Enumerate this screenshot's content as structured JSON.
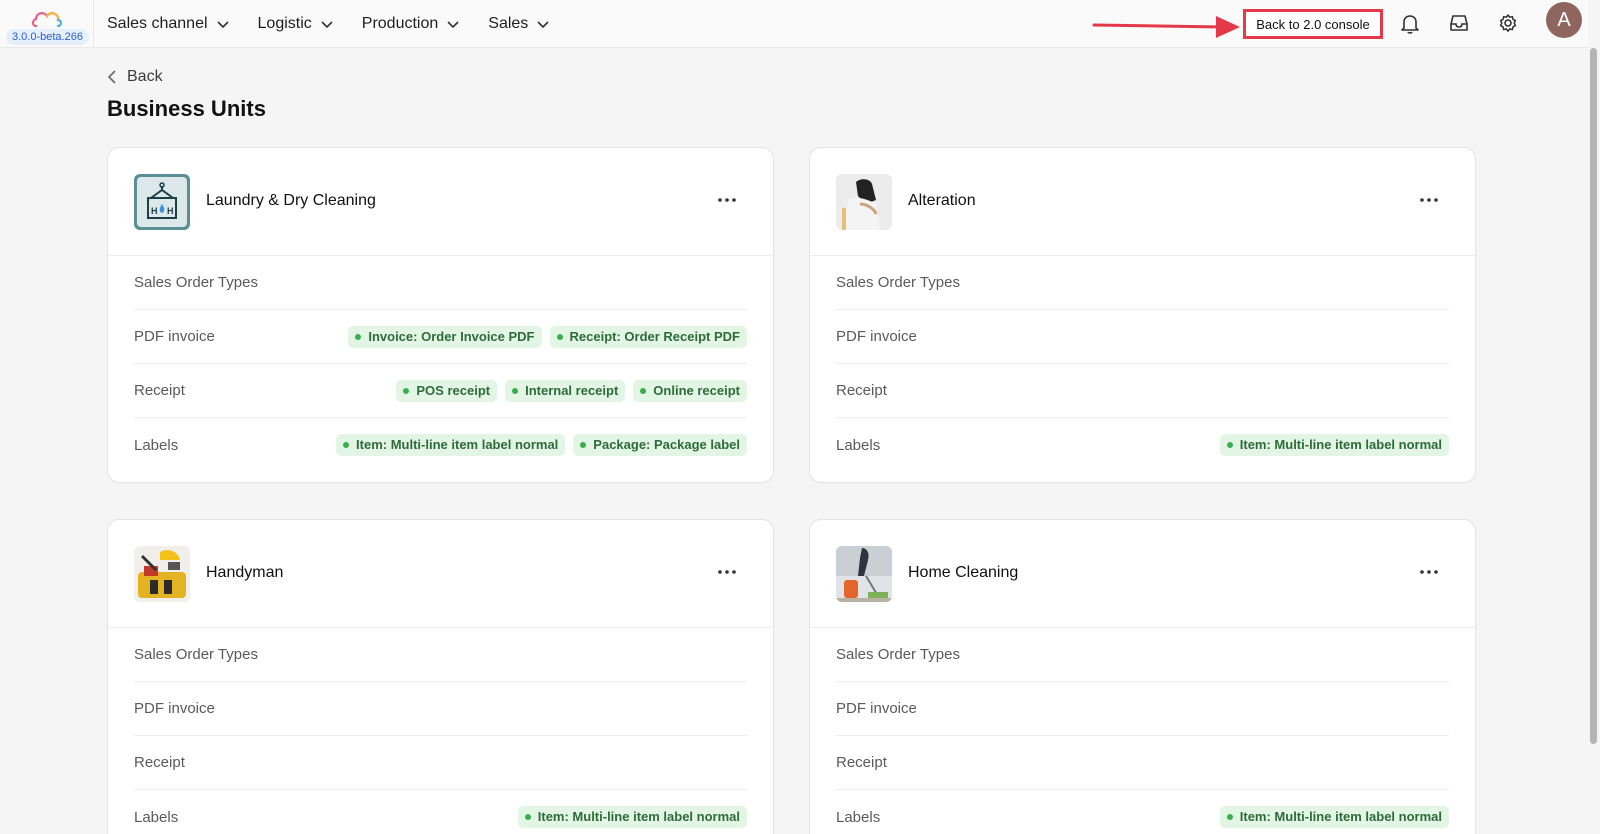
{
  "app": {
    "version": "3.0.0-beta.266"
  },
  "nav": {
    "items": [
      {
        "label": "Sales channel"
      },
      {
        "label": "Logistic"
      },
      {
        "label": "Production"
      },
      {
        "label": "Sales"
      }
    ]
  },
  "header": {
    "back_console_label": "Back to 2.0 console",
    "avatar_initial": "A",
    "icons": [
      "bell-icon",
      "inbox-icon",
      "gear-icon"
    ]
  },
  "page": {
    "back_label": "Back",
    "title": "Business Units"
  },
  "cards": [
    {
      "title": "Laundry & Dry Cleaning",
      "rows": [
        {
          "label": "Sales Order Types",
          "tags": []
        },
        {
          "label": "PDF invoice",
          "tags": [
            "Invoice: Order Invoice PDF",
            "Receipt: Order Receipt PDF"
          ]
        },
        {
          "label": "Receipt",
          "tags": [
            "POS receipt",
            "Internal receipt",
            "Online receipt"
          ]
        },
        {
          "label": "Labels",
          "tags": [
            "Item: Multi-line item label normal",
            "Package: Package label"
          ]
        }
      ]
    },
    {
      "title": "Alteration",
      "rows": [
        {
          "label": "Sales Order Types",
          "tags": []
        },
        {
          "label": "PDF invoice",
          "tags": []
        },
        {
          "label": "Receipt",
          "tags": []
        },
        {
          "label": "Labels",
          "tags": [
            "Item: Multi-line item label normal"
          ]
        }
      ]
    },
    {
      "title": "Handyman",
      "rows": [
        {
          "label": "Sales Order Types",
          "tags": []
        },
        {
          "label": "PDF invoice",
          "tags": []
        },
        {
          "label": "Receipt",
          "tags": []
        },
        {
          "label": "Labels",
          "tags": [
            "Item: Multi-line item label normal"
          ]
        }
      ]
    },
    {
      "title": "Home Cleaning",
      "rows": [
        {
          "label": "Sales Order Types",
          "tags": []
        },
        {
          "label": "PDF invoice",
          "tags": []
        },
        {
          "label": "Receipt",
          "tags": []
        },
        {
          "label": "Labels",
          "tags": [
            "Item: Multi-line item label normal"
          ]
        }
      ]
    }
  ],
  "colors": {
    "accent_red": "#e5394b",
    "tag_bg": "#e3f6e6",
    "tag_text": "#2f6b3a",
    "tag_dot": "#38b04a",
    "version_badge": "#2b5bd7"
  }
}
